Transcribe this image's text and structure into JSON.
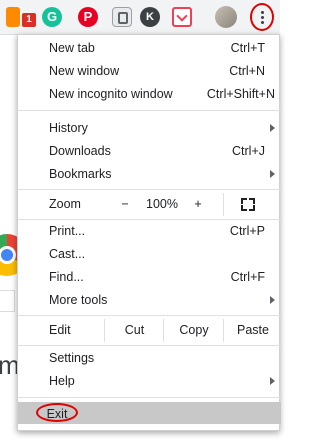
{
  "toolbar": {
    "extensions": [
      {
        "name": "orange-extension",
        "badge": "1"
      },
      {
        "name": "grammarly-extension",
        "glyph": "G"
      },
      {
        "name": "pinterest-extension",
        "glyph": "P"
      },
      {
        "name": "gray-extension"
      },
      {
        "name": "k-extension",
        "glyph": "K"
      },
      {
        "name": "pocket-extension"
      }
    ],
    "menu_button_highlight": "#e00000"
  },
  "menu": {
    "new_tab": {
      "label": "New tab",
      "shortcut": "Ctrl+T"
    },
    "new_window": {
      "label": "New window",
      "shortcut": "Ctrl+N"
    },
    "new_incognito": {
      "label": "New incognito window",
      "shortcut": "Ctrl+Shift+N"
    },
    "history": {
      "label": "History"
    },
    "downloads": {
      "label": "Downloads",
      "shortcut": "Ctrl+J"
    },
    "bookmarks": {
      "label": "Bookmarks"
    },
    "zoom": {
      "label": "Zoom",
      "minus": "−",
      "value": "100%",
      "plus": "+"
    },
    "print": {
      "label": "Print...",
      "shortcut": "Ctrl+P"
    },
    "cast": {
      "label": "Cast..."
    },
    "find": {
      "label": "Find...",
      "shortcut": "Ctrl+F"
    },
    "more_tools": {
      "label": "More tools"
    },
    "edit": {
      "label": "Edit",
      "cut": "Cut",
      "copy": "Copy",
      "paste": "Paste"
    },
    "settings": {
      "label": "Settings"
    },
    "help": {
      "label": "Help"
    },
    "exit": {
      "label": "Exit",
      "highlight": "#e00000"
    }
  },
  "page": {
    "fragment_text": "m"
  }
}
